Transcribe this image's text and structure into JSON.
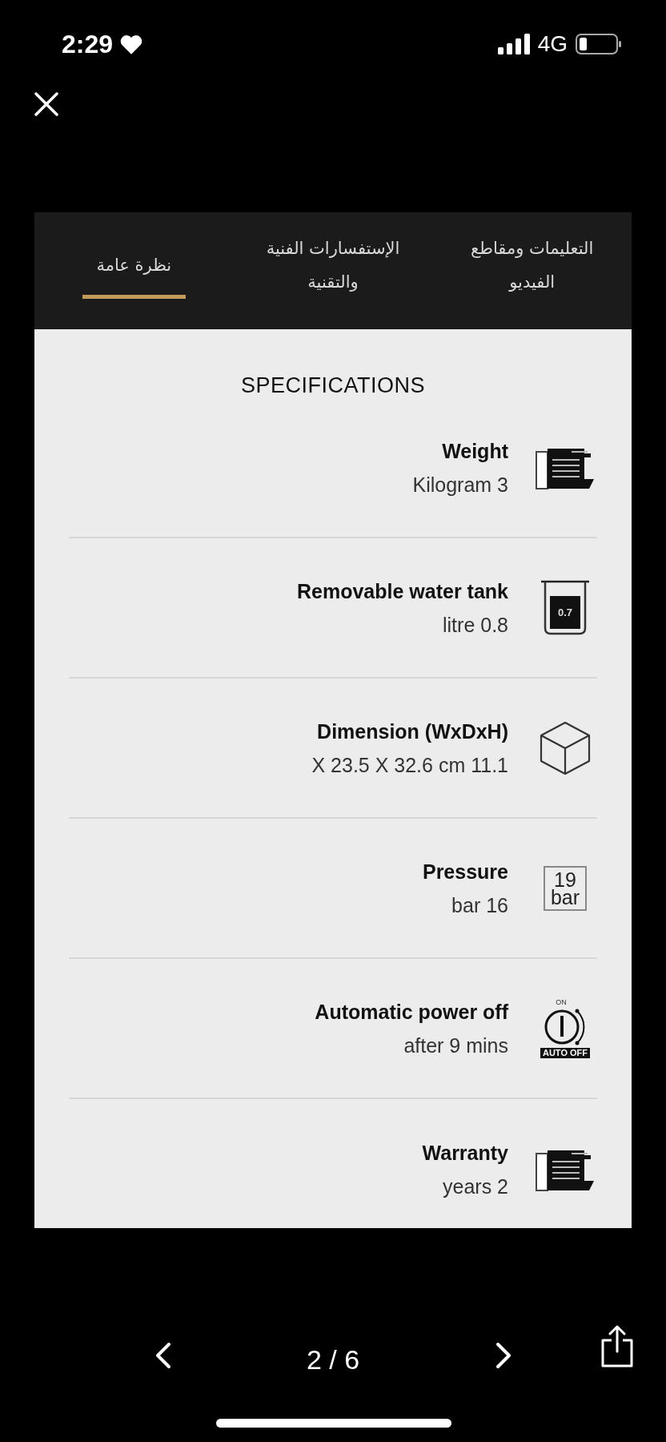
{
  "status_bar": {
    "time": "2:29",
    "network": "4G"
  },
  "tabs": [
    {
      "label": "التعليمات ومقاطع الفيديو",
      "selected": false
    },
    {
      "label": "الإستفسارات الفنية والتقنية",
      "selected": false
    },
    {
      "label": "نظرة عامة",
      "selected": true
    }
  ],
  "specifications": {
    "title": "SPECIFICATIONS",
    "items": [
      {
        "label": "Weight",
        "value": "Kilogram 3",
        "icon": {
          "kind": "machine"
        }
      },
      {
        "label": "Removable water tank",
        "value": "litre 0.8",
        "icon": {
          "kind": "tank",
          "text": "0.7"
        }
      },
      {
        "label": "Dimension (WxDxH)",
        "value": "X 23.5 X 32.6 cm 11.1",
        "icon": {
          "kind": "cube"
        }
      },
      {
        "label": "Pressure",
        "value": "bar 16",
        "icon": {
          "kind": "pressure",
          "text": "19",
          "unit": "bar"
        }
      },
      {
        "label": "Automatic power off",
        "value": "after 9 mins",
        "icon": {
          "kind": "autooff",
          "top": "ON",
          "text": "AUTO OFF"
        }
      },
      {
        "label": "Warranty",
        "value": "years 2",
        "icon": {
          "kind": "machine"
        }
      }
    ]
  },
  "viewer": {
    "counter": "2 / 6"
  }
}
